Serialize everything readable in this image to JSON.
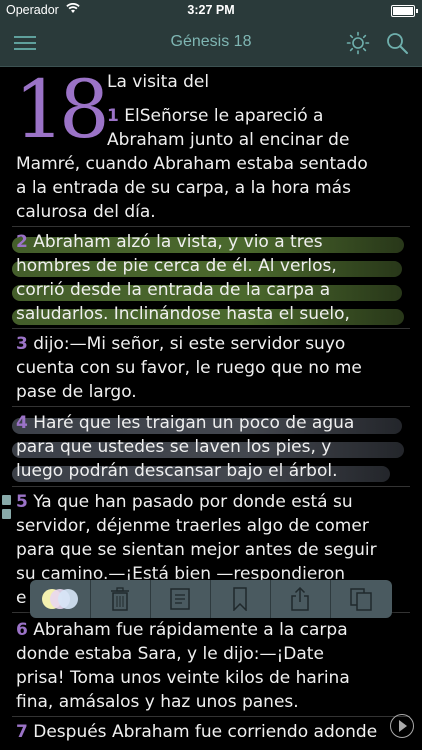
{
  "status_bar": {
    "carrier": "Operador",
    "time": "3:27 PM"
  },
  "header": {
    "title": "Génesis 18"
  },
  "chapter": {
    "number": "18",
    "heading": "La visita del",
    "verses": [
      {
        "num": "1",
        "lines": [
          "ElSeñorse le apareció a",
          "Abraham junto al encinar de",
          "Mamré, cuando Abraham estaba sentado",
          "a la entrada de su carpa, a la hora más",
          "calurosa del día."
        ]
      },
      {
        "num": "2",
        "lines": [
          "Abraham alzó la vista, y vio a tres",
          "hombres de pie cerca de él. Al verlos,",
          "corrió desde la entrada de la carpa a",
          "saludarlos. Inclinándose hasta el suelo,"
        ]
      },
      {
        "num": "3",
        "lines": [
          "dijo:—Mi señor, si este servidor suyo",
          "cuenta con su favor, le ruego que no me",
          "pase de largo."
        ]
      },
      {
        "num": "4",
        "lines": [
          "Haré que les traigan un poco de agua",
          "para que ustedes se laven los pies, y",
          "luego podrán descansar bajo el árbol."
        ]
      },
      {
        "num": "5",
        "lines": [
          "Ya que han pasado por donde está su",
          "servidor, déjenme traerles algo de comer",
          "para que se sientan mejor antes de seguir",
          "su camino.—¡Está bien —respondieron",
          "e"
        ]
      },
      {
        "num": "6",
        "lines": [
          "Abraham fue rápidamente a la carpa",
          "donde estaba Sara, y le dijo:—¡Date",
          "prisa! Toma unos veinte kilos de harina",
          "fina, amásalos y haz unos panes."
        ]
      },
      {
        "num": "7",
        "lines": [
          "Después Abraham fue corriendo adonde"
        ]
      }
    ]
  },
  "highlight_colors": {
    "verse2": "#6a8c3c",
    "verse4": "#5a5f69"
  },
  "icons": {
    "menu": "hamburger-icon",
    "theme": "sun-icon",
    "search": "search-icon",
    "toolbar": [
      "color-palette-icon",
      "trash-icon",
      "note-icon",
      "bookmark-icon",
      "share-icon",
      "copy-icon"
    ],
    "play": "play-icon"
  }
}
